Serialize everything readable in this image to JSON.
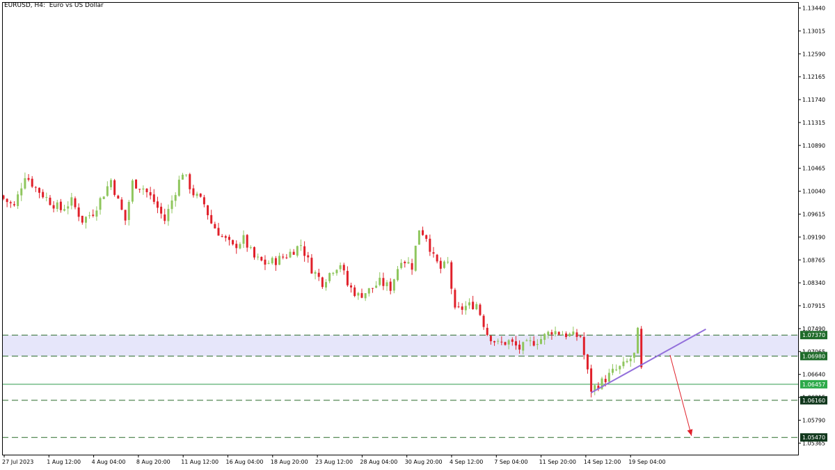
{
  "header": {
    "symbol": "EURUSD, H4:",
    "description": "Euro vs US Dollar"
  },
  "colors": {
    "background": "#ffffff",
    "frame": "#000000",
    "bull": "#8fc65e",
    "bear": "#e0202a",
    "zone": "#e6e6fa",
    "level_line": "#2a6b2a",
    "current_line": "#2e9a4a",
    "trendline": "#9370db",
    "arrow": "#e0202a",
    "price_tag_bg": "#1f6b2a",
    "current_tag_bg": "#2eaa4a",
    "dark_tag_bg": "#11381d"
  },
  "chart_data": {
    "type": "candlestick",
    "title": "EURUSD, H4: Euro vs US Dollar",
    "ylim": [
      1.0515,
      1.1355
    ],
    "y_ticks": [
      "1.13440",
      "1.13015",
      "1.12590",
      "1.12165",
      "1.11740",
      "1.11315",
      "1.10890",
      "1.10465",
      "1.10040",
      "1.09615",
      "1.09190",
      "1.08765",
      "1.08340",
      "1.07915",
      "1.07490",
      "1.07065",
      "1.06640",
      "1.06215",
      "1.05790",
      "1.05365"
    ],
    "x_ticks": [
      "27 Jul 2023",
      "1 Aug 12:00",
      "4 Aug 04:00",
      "8 Aug 20:00",
      "11 Aug 12:00",
      "16 Aug 04:00",
      "18 Aug 20:00",
      "23 Aug 12:00",
      "28 Aug 04:00",
      "30 Aug 20:00",
      "4 Sep 12:00",
      "7 Sep 04:00",
      "11 Sep 20:00",
      "14 Sep 12:00",
      "19 Sep 04:00"
    ],
    "candle_count": 179,
    "candle_close_path": [
      [
        0,
        1.099
      ],
      [
        3,
        1.0975
      ],
      [
        6,
        1.1035
      ],
      [
        9,
        1.101
      ],
      [
        13,
        1.0985
      ],
      [
        16,
        1.097
      ],
      [
        19,
        1.0985
      ],
      [
        22,
        1.095
      ],
      [
        25,
        1.0965
      ],
      [
        28,
        1.1
      ],
      [
        30,
        1.1025
      ],
      [
        32,
        1.0985
      ],
      [
        34,
        1.095
      ],
      [
        36,
        1.102
      ],
      [
        39,
        1.101
      ],
      [
        42,
        1.0985
      ],
      [
        45,
        1.095
      ],
      [
        48,
        1.1005
      ],
      [
        50,
        1.104
      ],
      [
        53,
        1.1
      ],
      [
        56,
        1.098
      ],
      [
        58,
        1.0945
      ],
      [
        61,
        1.092
      ],
      [
        64,
        1.09
      ],
      [
        67,
        1.0915
      ],
      [
        70,
        1.088
      ],
      [
        73,
        1.087
      ],
      [
        76,
        1.0875
      ],
      [
        79,
        1.0885
      ],
      [
        83,
        1.0905
      ],
      [
        86,
        1.086
      ],
      [
        89,
        1.0835
      ],
      [
        92,
        1.086
      ],
      [
        94,
        1.087
      ],
      [
        96,
        1.083
      ],
      [
        99,
        1.081
      ],
      [
        102,
        1.082
      ],
      [
        105,
        1.0835
      ],
      [
        108,
        1.0825
      ],
      [
        111,
        1.088
      ],
      [
        114,
        1.0865
      ],
      [
        116,
        1.0935
      ],
      [
        118,
        1.092
      ],
      [
        120,
        1.088
      ],
      [
        122,
        1.086
      ],
      [
        124,
        1.087
      ],
      [
        126,
        1.078
      ],
      [
        129,
        1.079
      ],
      [
        132,
        1.0795
      ],
      [
        135,
        1.074
      ],
      [
        138,
        1.072
      ],
      [
        141,
        1.0725
      ],
      [
        144,
        1.0712
      ],
      [
        147,
        1.0722
      ],
      [
        150,
        1.073
      ],
      [
        153,
        1.0745
      ],
      [
        156,
        1.074
      ],
      [
        159,
        1.0735
      ],
      [
        161,
        1.0735
      ],
      [
        162,
        1.07
      ],
      [
        164,
        1.0636
      ],
      [
        167,
        1.065
      ],
      [
        170,
        1.0668
      ],
      [
        173,
        1.068
      ],
      [
        176,
        1.07
      ],
      [
        177,
        1.0742
      ],
      [
        178,
        1.0672
      ],
      [
        180,
        1.0626
      ],
      [
        182,
        1.0643
      ]
    ],
    "levels": [
      {
        "price": 1.0737,
        "label": "1.07370",
        "style": "dashed"
      },
      {
        "price": 1.0698,
        "label": "1.06980",
        "style": "dashed"
      },
      {
        "price": 1.0616,
        "label": "1.06160",
        "style": "dashed"
      },
      {
        "price": 1.0547,
        "label": "1.05470",
        "style": "dashed"
      }
    ],
    "resistance_zone": [
      1.0698,
      1.0737
    ],
    "current_price": {
      "price": 1.06457,
      "label": "1.06457"
    },
    "trendline": {
      "from": [
        164,
        1.063
      ],
      "to": [
        196,
        1.0748
      ]
    },
    "projection_arrow": {
      "from": [
        186,
        1.07
      ],
      "to": [
        192,
        1.055
      ]
    },
    "grid": false,
    "legend": "none"
  }
}
